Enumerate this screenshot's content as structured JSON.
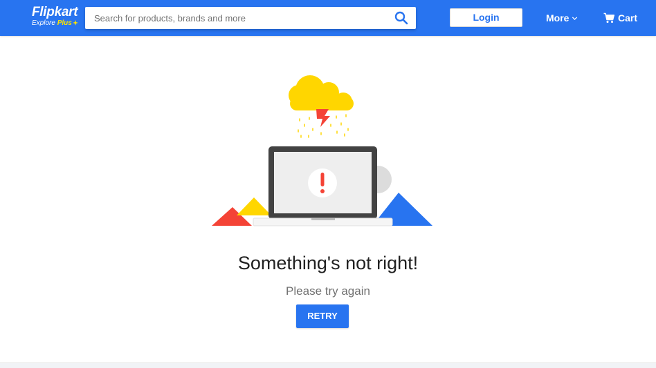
{
  "header": {
    "logo": {
      "name": "Flipkart",
      "tagline_prefix": "Explore",
      "tagline_plus": "Plus"
    },
    "search": {
      "placeholder": "Search for products, brands and more",
      "value": "",
      "icon": "search-icon"
    },
    "login_label": "Login",
    "more_label": "More",
    "cart_label": "Cart"
  },
  "error": {
    "title": "Something's not right!",
    "subtitle": "Please try again",
    "retry_label": "RETRY"
  },
  "colors": {
    "brand_blue": "#2874f0",
    "brand_yellow": "#ffe500",
    "cloud_yellow": "#ffd600",
    "bolt_red": "#f44336",
    "triangle_red": "#f44336",
    "triangle_yellow": "#ffd600",
    "triangle_blue": "#2874f0"
  }
}
